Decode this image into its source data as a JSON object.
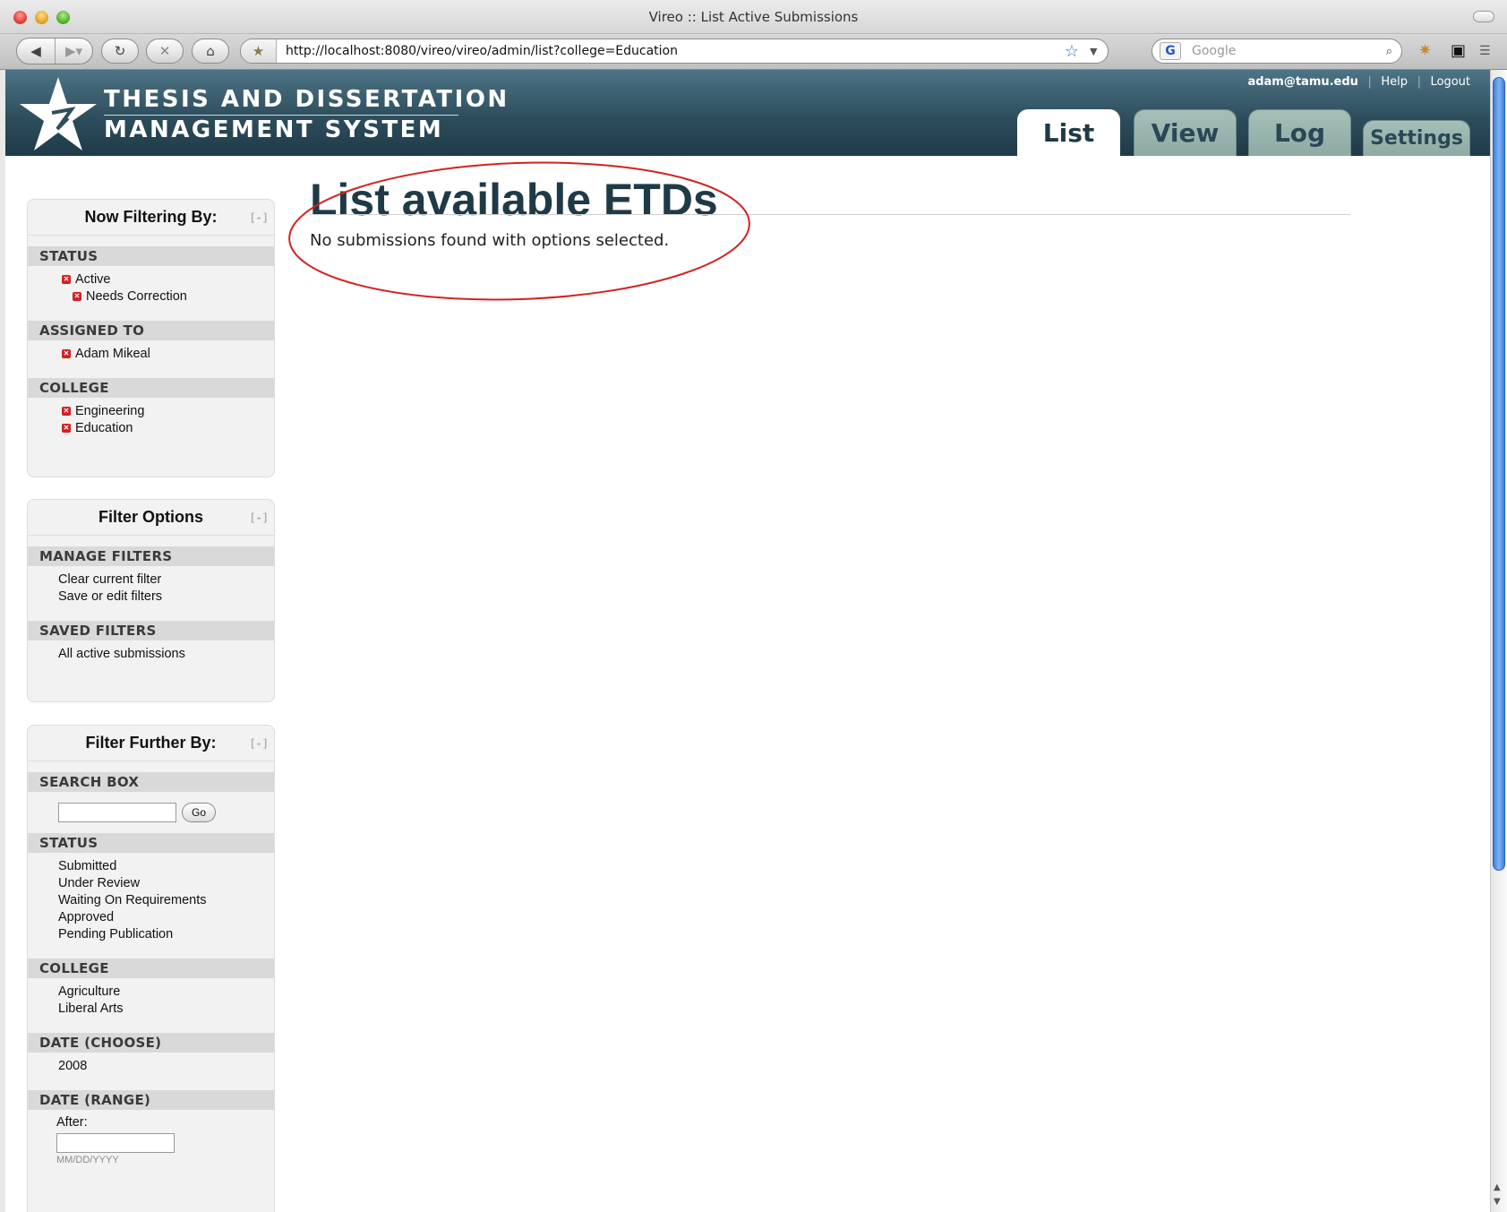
{
  "window": {
    "title": "Vireo :: List Active Submissions"
  },
  "browser": {
    "url": "http://localhost:8080/vireo/vireo/admin/list?college=Education",
    "search_placeholder": "Google"
  },
  "header": {
    "logo_line1": "THESIS AND DISSERTATION",
    "logo_line2": "MANAGEMENT SYSTEM",
    "user_email": "adam@tamu.edu",
    "help": "Help",
    "logout": "Logout",
    "tabs": [
      {
        "label": "List",
        "active": true
      },
      {
        "label": "View",
        "active": false
      },
      {
        "label": "Log",
        "active": false
      },
      {
        "label": "Settings",
        "active": false
      }
    ]
  },
  "now_filtering": {
    "title": "Now Filtering By:",
    "collapse": "[-]",
    "sections": [
      {
        "heading": "STATUS",
        "items": [
          "Active",
          "Needs Correction"
        ]
      },
      {
        "heading": "ASSIGNED TO",
        "items": [
          "Adam Mikeal"
        ]
      },
      {
        "heading": "COLLEGE",
        "items": [
          "Engineering",
          "Education"
        ]
      }
    ]
  },
  "filter_options": {
    "title": "Filter Options",
    "collapse": "[-]",
    "manage_heading": "MANAGE FILTERS",
    "manage_items": [
      "Clear current filter",
      "Save or edit filters"
    ],
    "saved_heading": "SAVED FILTERS",
    "saved_items": [
      "All active submissions"
    ]
  },
  "filter_further": {
    "title": "Filter Further By:",
    "collapse": "[-]",
    "search_heading": "SEARCH BOX",
    "search_value": "",
    "go_label": "Go",
    "status_heading": "STATUS",
    "status_items": [
      "Submitted",
      "Under Review",
      "Waiting On Requirements",
      "Approved",
      "Pending Publication"
    ],
    "college_heading": "COLLEGE",
    "college_items": [
      "Agriculture",
      "Liberal Arts"
    ],
    "date_choose_heading": "DATE (CHOOSE)",
    "date_choose_items": [
      "2008"
    ],
    "date_range_heading": "DATE (RANGE)",
    "after_label": "After:",
    "date_hint": "MM/DD/YYYY"
  },
  "main": {
    "title": "List available ETDs",
    "empty_message": "No submissions found with options selected."
  },
  "colors": {
    "header_dark": "#1f3a47",
    "annotation": "#d42020",
    "scroll_thumb": "#3f7fdc"
  }
}
